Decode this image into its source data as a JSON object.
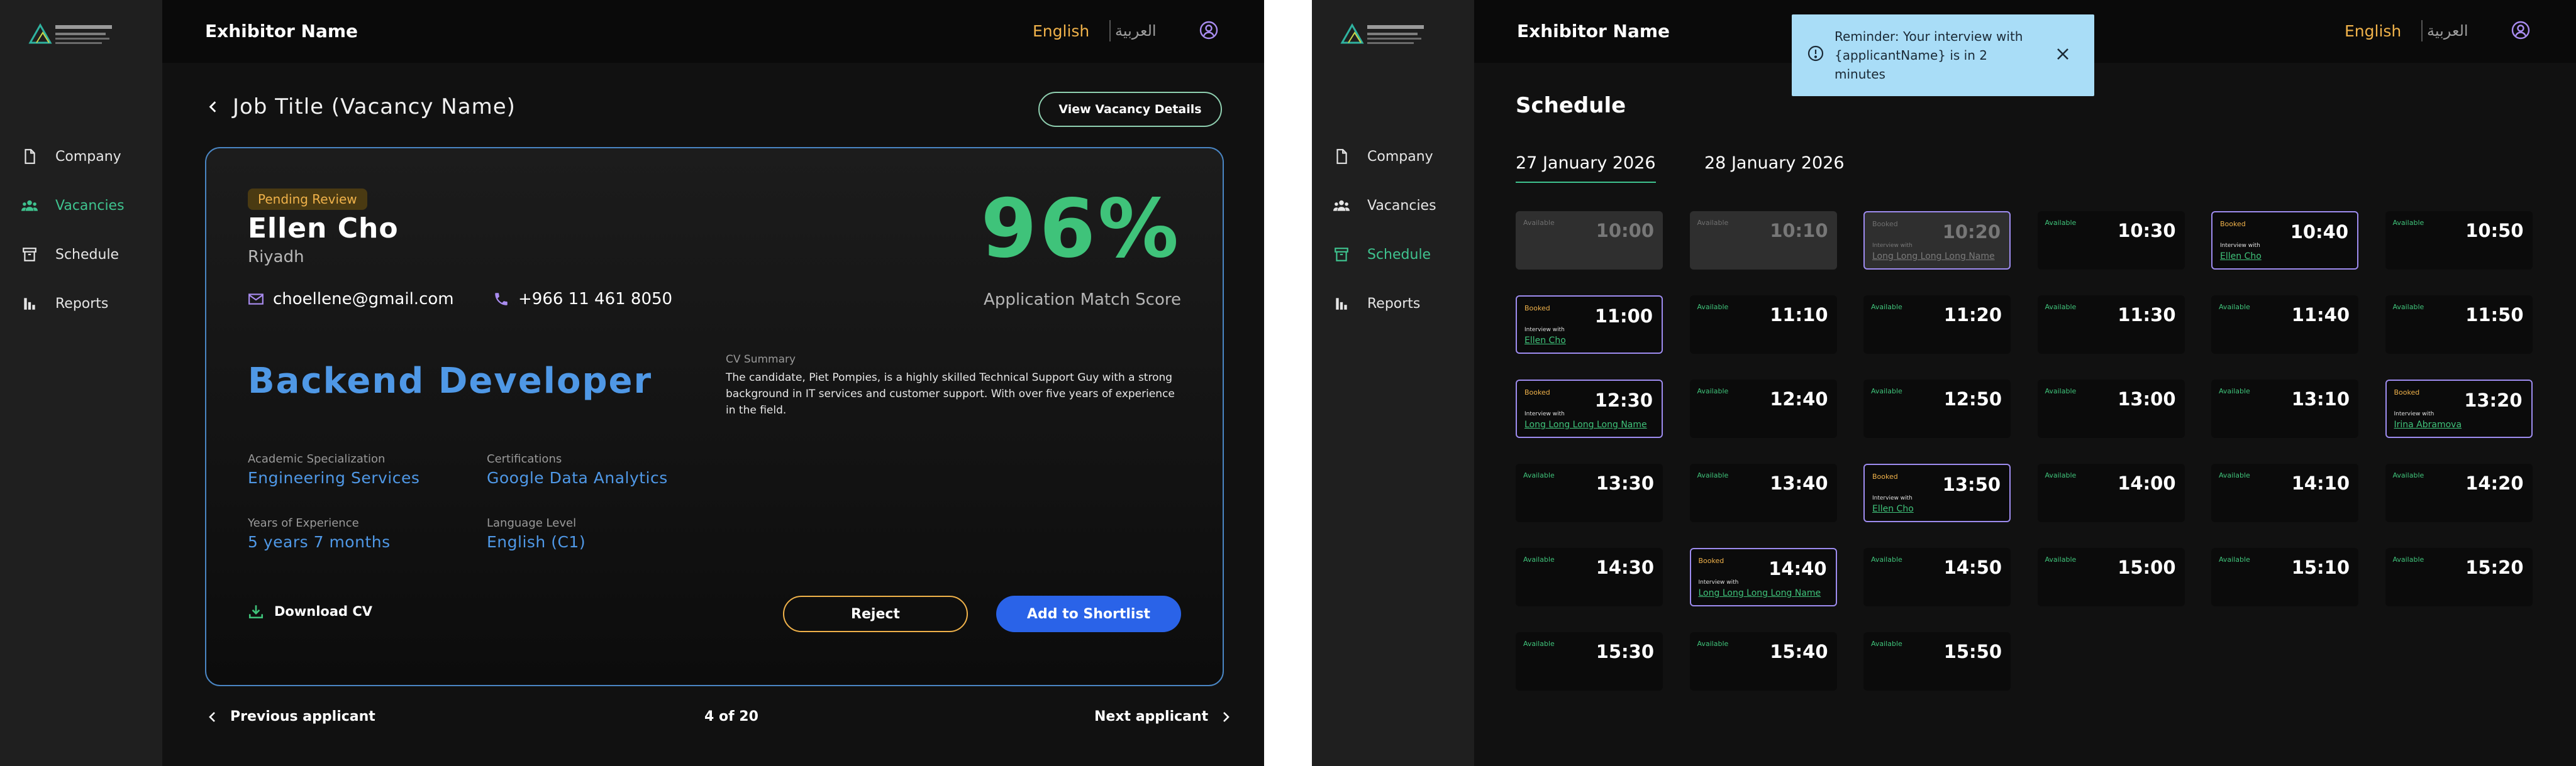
{
  "colors": {
    "accent_green": "#3fc38f",
    "accent_orange": "#f0b24a",
    "accent_blue": "#4f98e6",
    "primary_button": "#2a63e8",
    "booked_border": "#9e8cf0",
    "toast_bg": "#a9ddf7"
  },
  "header": {
    "exhibitor": "Exhibitor Name",
    "lang_en": "English",
    "lang_ar": "العربية"
  },
  "sidebar": {
    "items": [
      {
        "label": "Company",
        "icon": "document-icon"
      },
      {
        "label": "Vacancies",
        "icon": "people-icon"
      },
      {
        "label": "Schedule",
        "icon": "archive-icon"
      },
      {
        "label": "Reports",
        "icon": "bar-chart-icon"
      }
    ]
  },
  "screen1": {
    "job_title": "Job Title (Vacancy Name)",
    "view_details": "View Vacancy Details",
    "status": "Pending Review",
    "name": "Ellen Cho",
    "city": "Riyadh",
    "email": "choellene@gmail.com",
    "phone": "+966 11 461 8050",
    "match_score": "96%",
    "match_label": "Application Match Score",
    "role": "Backend Developer",
    "cv_summary_label": "CV Summary",
    "cv_summary": "The candidate, Piet Pompies, is a highly skilled Technical Support Guy with a strong background in IT services and customer support. With over five years of experience in the field.",
    "fields": {
      "academic_label": "Academic Specialization",
      "academic_value": "Engineering Services",
      "cert_label": "Certifications",
      "cert_value": "Google Data Analytics",
      "exp_label": "Years of Experience",
      "exp_value": "5 years 7 months",
      "lang_label": "Language Level",
      "lang_value": "English (C1)"
    },
    "download": "Download CV",
    "reject": "Reject",
    "shortlist": "Add to Shortlist",
    "prev": "Previous applicant",
    "count": "4 of 20",
    "next": "Next applicant"
  },
  "screen2": {
    "title": "Schedule",
    "dates": [
      "27 January 2026",
      "28 January 2026"
    ],
    "active_date": 0,
    "toast": "Reminder: Your interview with {applicantName} is in 2 minutes",
    "interview_with": "Interview with",
    "slots": [
      {
        "time": "10:00",
        "status": "Available",
        "past": true
      },
      {
        "time": "10:10",
        "status": "Available",
        "past": true
      },
      {
        "time": "10:20",
        "status": "Booked",
        "past": true,
        "name": "Long Long Long Long Name"
      },
      {
        "time": "10:30",
        "status": "Available"
      },
      {
        "time": "10:40",
        "status": "Booked",
        "name": "Ellen Cho"
      },
      {
        "time": "10:50",
        "status": "Available"
      },
      {
        "time": "11:00",
        "status": "Booked",
        "name": "Ellen Cho"
      },
      {
        "time": "11:10",
        "status": "Available"
      },
      {
        "time": "11:20",
        "status": "Available"
      },
      {
        "time": "11:30",
        "status": "Available"
      },
      {
        "time": "11:40",
        "status": "Available"
      },
      {
        "time": "11:50",
        "status": "Available"
      },
      {
        "time": "12:30",
        "status": "Booked",
        "name": "Long Long Long Long Name"
      },
      {
        "time": "12:40",
        "status": "Available"
      },
      {
        "time": "12:50",
        "status": "Available"
      },
      {
        "time": "13:00",
        "status": "Available"
      },
      {
        "time": "13:10",
        "status": "Available"
      },
      {
        "time": "13:20",
        "status": "Booked",
        "name": "Irina Abramova"
      },
      {
        "time": "13:30",
        "status": "Available"
      },
      {
        "time": "13:40",
        "status": "Available"
      },
      {
        "time": "13:50",
        "status": "Booked",
        "name": "Ellen Cho"
      },
      {
        "time": "14:00",
        "status": "Available"
      },
      {
        "time": "14:10",
        "status": "Available"
      },
      {
        "time": "14:20",
        "status": "Available"
      },
      {
        "time": "14:30",
        "status": "Available"
      },
      {
        "time": "14:40",
        "status": "Booked",
        "name": "Long Long Long Long Name"
      },
      {
        "time": "14:50",
        "status": "Available"
      },
      {
        "time": "15:00",
        "status": "Available"
      },
      {
        "time": "15:10",
        "status": "Available"
      },
      {
        "time": "15:20",
        "status": "Available"
      },
      {
        "time": "15:30",
        "status": "Available"
      },
      {
        "time": "15:40",
        "status": "Available"
      },
      {
        "time": "15:50",
        "status": "Available"
      }
    ]
  }
}
